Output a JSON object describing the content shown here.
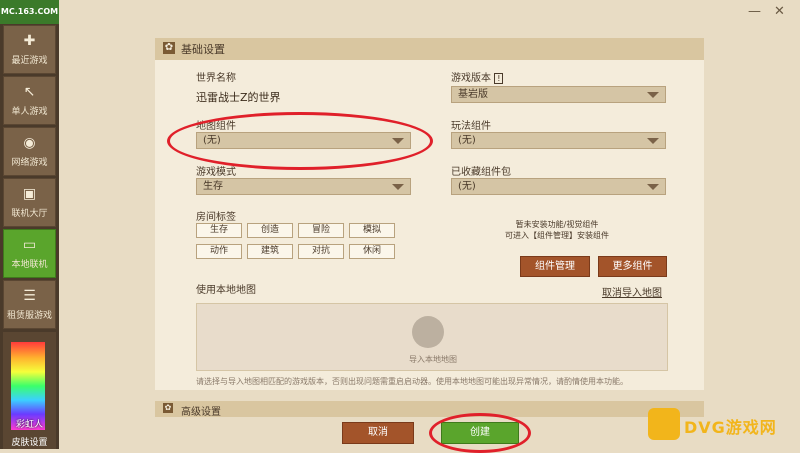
{
  "app": {
    "logo": "MC.163.COM"
  },
  "sidebar": {
    "items": [
      {
        "label": "最近游戏",
        "icon": "gamepad-icon"
      },
      {
        "label": "单人游戏",
        "icon": "arrow-icon"
      },
      {
        "label": "网络游戏",
        "icon": "globe-icon"
      },
      {
        "label": "联机大厅",
        "icon": "monitor-group-icon"
      },
      {
        "label": "本地联机",
        "icon": "lan-icon",
        "active": true
      },
      {
        "label": "租赁服游戏",
        "icon": "list-icon"
      }
    ],
    "skin": {
      "name": "彩虹人",
      "label": "皮肤设置"
    }
  },
  "window": {
    "minimize": "—",
    "close": "✕"
  },
  "basic": {
    "title": "基础设置",
    "world_name_label": "世界名称",
    "world_name_value": "迅雷战士Z的世界",
    "version_label": "游戏版本",
    "version_value": "基岩版",
    "map_component_label": "地图组件",
    "map_component_value": "(无)",
    "gameplay_label": "玩法组件",
    "gameplay_value": "(无)",
    "game_mode_label": "游戏模式",
    "game_mode_value": "生存",
    "saved_pack_label": "已收藏组件包",
    "saved_pack_value": "(无)",
    "room_tags_label": "房间标签",
    "tags": [
      "生存",
      "创造",
      "冒险",
      "模拟",
      "动作",
      "建筑",
      "对抗",
      "休闲"
    ],
    "no_component_note_line1": "暂未安装功能/视觉组件",
    "no_component_note_line2": "可进入【组件管理】安装组件",
    "manage_button": "组件管理",
    "more_button": "更多组件",
    "local_map_label": "使用本地地图",
    "cancel_import_link": "取消导入地图",
    "import_label": "导入本地地图",
    "footer_note": "请选择与导入地图相匹配的游戏版本，否则出现问题需重启启动器。使用本地地图可能出现异常情况，请酌情使用本功能。"
  },
  "advanced": {
    "title": "高级设置"
  },
  "footer": {
    "cancel": "取消",
    "create": "创建"
  },
  "watermark": {
    "text": "DVG游戏网"
  },
  "colors": {
    "accent_green": "#5aa52c",
    "accent_brown": "#a3542a",
    "annotation_red": "#e0202a"
  }
}
